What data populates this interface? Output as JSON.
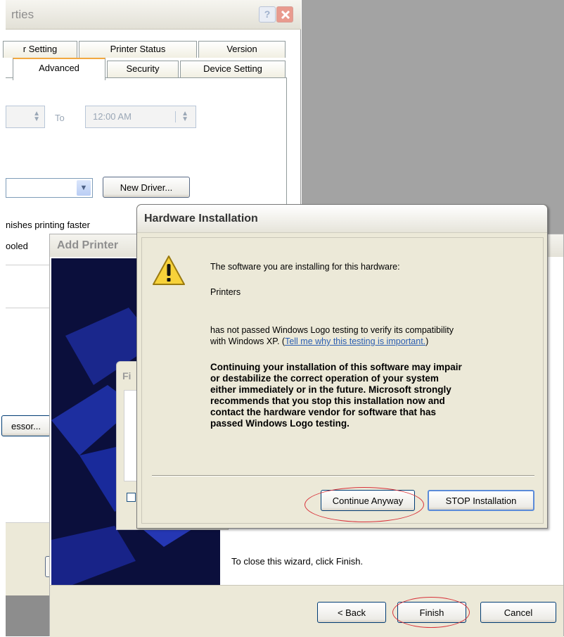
{
  "printer_properties": {
    "title": "rties",
    "tabs_back": [
      "r Setting",
      "Printer Status",
      "Version"
    ],
    "tabs_front": [
      "Advanced",
      "Security",
      "Device Setting"
    ],
    "to_label": "To",
    "time_value": "12:00 AM",
    "new_driver_label": "New Driver...",
    "option1": "nishes printing faster",
    "option2": "ooled",
    "processor_label": "essor..."
  },
  "add_printer_wizard": {
    "title": "Add Printer",
    "subdialog_title": "Fi",
    "close_text": "To close this wizard, click Finish.",
    "back_label": "< Back",
    "finish_label": "Finish",
    "cancel_label": "Cancel"
  },
  "hardware_dialog": {
    "title": "Hardware Installation",
    "intro": "The software you are installing for this hardware:",
    "device": "Printers",
    "message_line1": "has not passed Windows Logo testing to verify its compatibility",
    "message_line2": "with Windows XP. (",
    "link": "Tell me why this testing is important.",
    "message_close": ")",
    "warning_lines": [
      "Continuing your installation of this software may impair",
      "or destabilize the correct operation of your system",
      "either immediately or in the future. Microsoft strongly",
      "recommends that you stop this installation now and",
      "contact the hardware vendor for software that has",
      "passed Windows Logo testing."
    ],
    "continue_label": "Continue Anyway",
    "stop_label": "STOP Installation"
  },
  "colors": {
    "desktop_gray": "#a3a3a3",
    "dialog_face": "#ece9d8",
    "link_blue": "#2a5db0",
    "highlight_red": "#d8323a"
  }
}
